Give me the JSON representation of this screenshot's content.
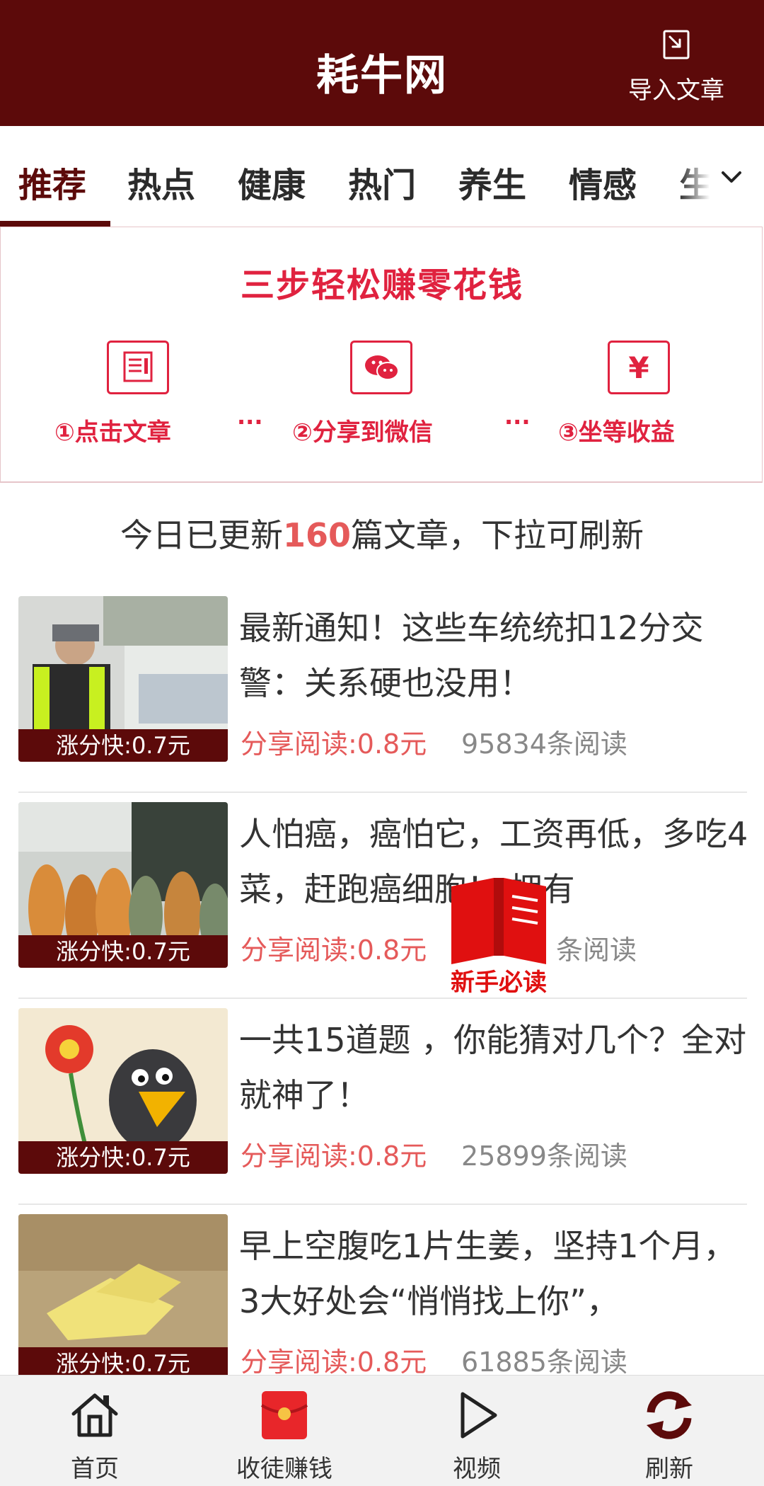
{
  "header": {
    "title": "耗牛网",
    "import_label": "导入文章"
  },
  "tabs": [
    {
      "label": "推荐"
    },
    {
      "label": "热点"
    },
    {
      "label": "健康"
    },
    {
      "label": "热门"
    },
    {
      "label": "养生"
    },
    {
      "label": "情感"
    },
    {
      "label": "生"
    }
  ],
  "banner": {
    "title": "三步轻松赚零花钱",
    "steps": [
      {
        "label": "①点击文章",
        "icon": "article-icon"
      },
      {
        "label": "②分享到微信",
        "icon": "wechat-icon"
      },
      {
        "label": "③坐等收益",
        "icon": "yen-icon"
      }
    ],
    "dots": "···"
  },
  "update": {
    "prefix": "今日已更新",
    "count": "160",
    "suffix": "篇文章，下拉可刷新"
  },
  "articles": [
    {
      "title": "最新通知！这些车统统扣12分交警：关系硬也没用！",
      "badge": "涨分快:0.7元",
      "earn": "分享阅读:0.8元",
      "reads": "95834条阅读"
    },
    {
      "title": "人怕癌，癌怕它，工资再低，多吃4菜，赶跑癌细胞！ 拥有",
      "badge": "涨分快:0.7元",
      "earn": "分享阅读:0.8元",
      "reads": "条阅读"
    },
    {
      "title": "一共15道题 ，你能猜对几个？全对就神了！",
      "badge": "涨分快:0.7元",
      "earn": "分享阅读:0.8元",
      "reads": "25899条阅读"
    },
    {
      "title": "早上空腹吃1片生姜，坚持1个月，3大好处会“悄悄找上你”，",
      "badge": "涨分快:0.7元",
      "earn": "分享阅读:0.8元",
      "reads": "61885条阅读"
    }
  ],
  "newbie": {
    "label": "新手必读"
  },
  "bottom_nav": [
    {
      "label": "首页",
      "icon": "home-icon"
    },
    {
      "label": "收徒赚钱",
      "icon": "red-envelope-icon"
    },
    {
      "label": "视频",
      "icon": "play-icon"
    },
    {
      "label": "刷新",
      "icon": "refresh-icon"
    }
  ],
  "colors": {
    "brand": "#5c0a0a",
    "accent": "#e0223f",
    "earn": "#e55a5a"
  }
}
